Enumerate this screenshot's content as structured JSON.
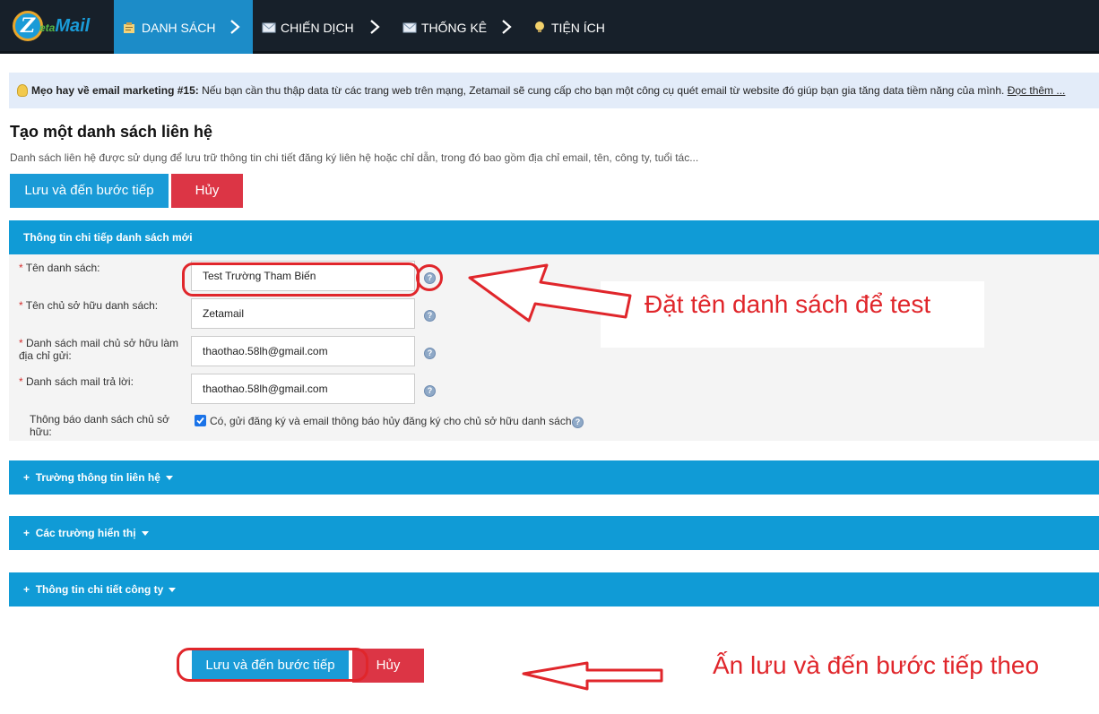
{
  "nav": {
    "logo": {
      "letter": "Z",
      "text": "eta",
      "text2": "Mail"
    },
    "items": [
      {
        "label": "DANH SÁCH",
        "icon": "clipboard-icon"
      },
      {
        "label": "CHIẾN DỊCH",
        "icon": "envelope-icon"
      },
      {
        "label": "THỐNG KÊ",
        "icon": "envelope-icon"
      },
      {
        "label": "TIỆN ÍCH",
        "icon": "lightbulb-icon"
      }
    ]
  },
  "tip": {
    "title": "Mẹo hay về email marketing #15:",
    "text": " Nếu bạn cần thu thập data từ các trang web trên mạng, Zetamail sẽ cung cấp cho bạn một công cụ quét email từ website đó giúp bạn gia tăng data tiềm năng của mình. ",
    "more": "Đọc thêm ..."
  },
  "page": {
    "title": "Tạo một danh sách liên hệ",
    "description": "Danh sách liên hệ được sử dụng để lưu trữ thông tin chi tiết đăng ký liên hệ hoặc chỉ dẫn, trong đó bao gồm địa chỉ email, tên, công ty, tuổi tác..."
  },
  "buttons": {
    "save_next": "Lưu và đến bước tiếp",
    "cancel": "Hủy"
  },
  "form": {
    "section_title": "Thông tin chi tiếp danh sách mới",
    "fields": [
      {
        "label": "Tên danh sách:",
        "value": "Test Trường Tham Biến"
      },
      {
        "label": "Tên chủ sở hữu danh sách:",
        "value": "Zetamail"
      },
      {
        "label": "Danh sách mail chủ sở hữu làm địa chỉ gửi:",
        "value": "thaothao.58lh@gmail.com"
      },
      {
        "label": "Danh sách mail trả lời:",
        "value": "thaothao.58lh@gmail.com"
      }
    ],
    "required_mark": "*",
    "help_glyph": "?",
    "notify": {
      "label": "Thông báo danh sách chủ sở hữu:",
      "checked": true,
      "checkbox_label": "Có, gửi đăng ký và email thông báo hủy đăng ký cho chủ sở hữu danh sách"
    }
  },
  "sections": [
    {
      "label": "Trường thông tin liên hệ"
    },
    {
      "label": "Các trường hiển thị"
    },
    {
      "label": "Thông tin chi tiết công ty"
    }
  ],
  "expand_glyph": "+",
  "annotations": {
    "name_hint": "Đặt tên danh sách để test",
    "save_hint": "Ấn lưu và đến bước tiếp theo"
  },
  "colors": {
    "nav_bg": "#17202a",
    "nav_active": "#1c8cc8",
    "primary": "#1a9bd7",
    "danger": "#dc3545",
    "section": "#109bd6",
    "annotation": "#e0262b"
  }
}
